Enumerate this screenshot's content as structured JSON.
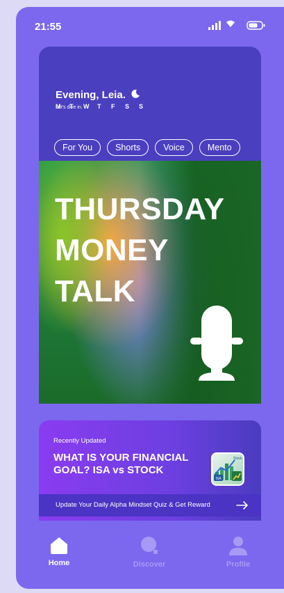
{
  "status_bar": {
    "time": "21:55",
    "icons": [
      "signal-icon",
      "wifi-icon",
      "battery-icon"
    ]
  },
  "header": {
    "days": [
      "M",
      "T",
      "W",
      "T",
      "F",
      "S",
      "S"
    ],
    "greeting": "Evening, Leia.",
    "greeting_icon": "moon-icon",
    "subgreeting": "Let's dive in."
  },
  "tabs": [
    {
      "label": "For You"
    },
    {
      "label": "Shorts"
    },
    {
      "label": "Voice"
    },
    {
      "label": "Mento"
    }
  ],
  "banner": {
    "title_lines": [
      "THURSDAY",
      "MONEY",
      "TALK"
    ],
    "icon": "microphone-icon"
  },
  "update_card": {
    "kicker": "Recently Updated",
    "title": "WHAT IS YOUR FINANCIAL GOAL? ISA vs STOCK",
    "thumb_labels": {
      "isa": "ISA",
      "stock": "Stock"
    },
    "bar_text": "Update Your Daily Alpha Mindset Quiz & Get Reward",
    "bar_icon": "arrow-right-icon"
  },
  "bottom_nav": {
    "items": [
      {
        "label": "Home",
        "icon": "home-icon",
        "active": true
      },
      {
        "label": "Discover",
        "icon": "search-icon",
        "active": false
      },
      {
        "label": "Profile",
        "icon": "profile-icon",
        "active": false
      }
    ]
  },
  "colors": {
    "background": "#7b68ee",
    "card": "#4a3fbf",
    "active_nav": "#ffffff",
    "inactive_nav": "#a79af5"
  }
}
